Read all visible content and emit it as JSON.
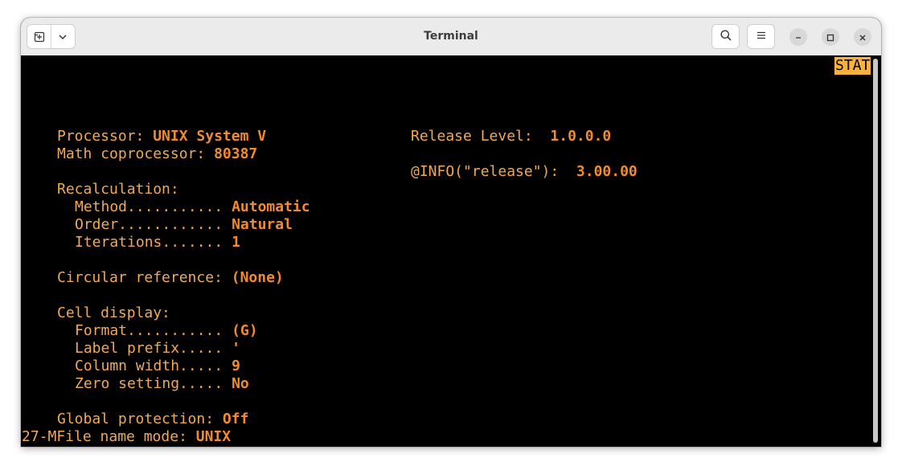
{
  "window": {
    "title": "Terminal"
  },
  "icons": {
    "new_tab": "new-tab-icon",
    "dropdown": "chevron-down-icon",
    "search": "search-icon",
    "menu": "hamburger-menu-icon",
    "minimize": "minimize-icon",
    "maximize": "maximize-icon",
    "close": "close-icon"
  },
  "colors": {
    "label": "#f0a956",
    "value": "#f18b2f",
    "status_bg": "#f7b13c",
    "terminal_bg": "#000000"
  },
  "terminal": {
    "status": "STAT",
    "processor": {
      "label": "Processor: ",
      "value": "UNIX System V"
    },
    "math": {
      "label": "Math coprocessor: ",
      "value": "80387"
    },
    "release": {
      "label": "Release Level:  ",
      "value": "1.0.0.0"
    },
    "info": {
      "label": "@INFO(\"release\"):  ",
      "value": "3.00.00"
    },
    "recalc": {
      "heading": "Recalculation:",
      "method": {
        "label": "Method........... ",
        "value": "Automatic"
      },
      "order": {
        "label": "Order............ ",
        "value": "Natural"
      },
      "iterations": {
        "label": "Iterations....... ",
        "value": "1"
      }
    },
    "circular": {
      "label": "Circular reference: ",
      "value": "(None)"
    },
    "cell": {
      "heading": "Cell display:",
      "format": {
        "label": "Format........... ",
        "value": "(G)"
      },
      "prefix": {
        "label": "Label prefix..... ",
        "value": "'"
      },
      "width": {
        "label": "Column width..... ",
        "value": "9"
      },
      "zero": {
        "label": "Zero setting..... ",
        "value": "No"
      }
    },
    "protection": {
      "label": "Global protection: ",
      "value": "Off"
    },
    "filename": {
      "label": "27-MFile name mode: ",
      "value": "UNIX"
    }
  }
}
